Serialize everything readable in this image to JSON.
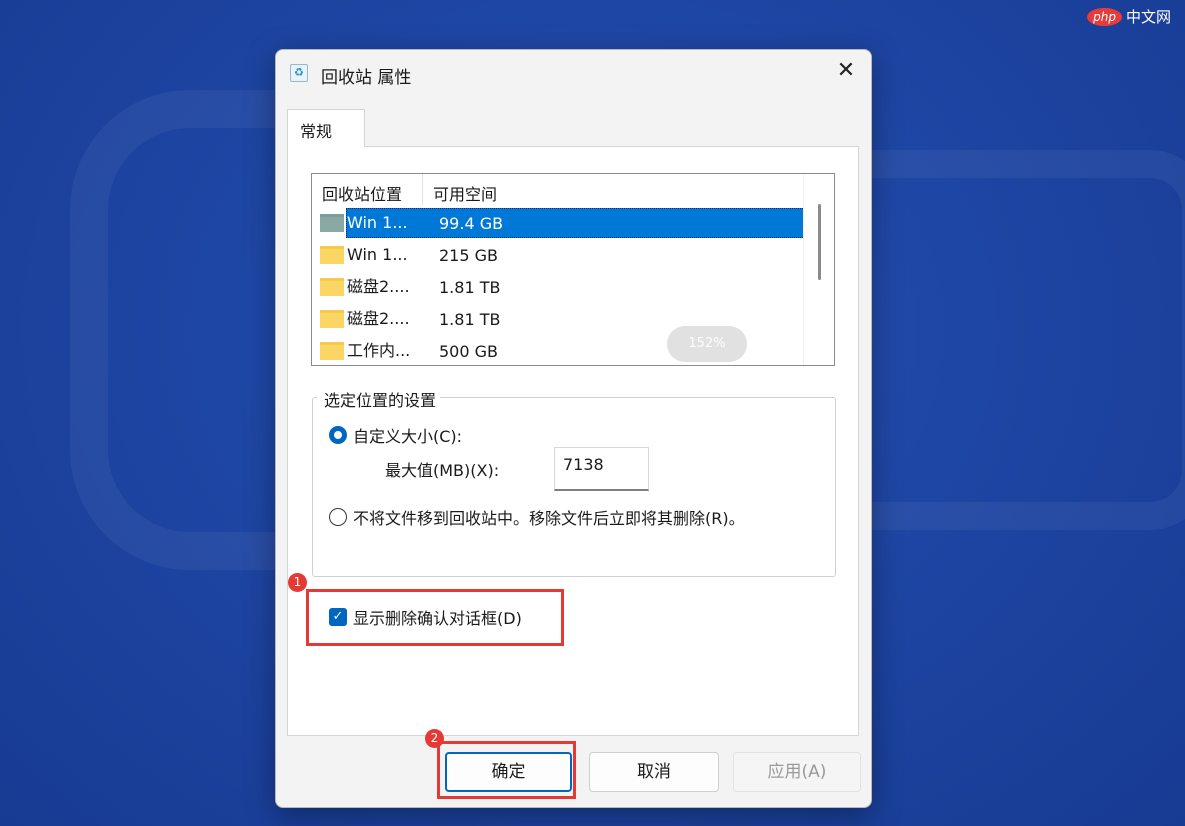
{
  "watermark": {
    "logo": "php",
    "text": "中文网"
  },
  "dialog": {
    "title": "回收站 属性",
    "close_glyph": "✕",
    "tab_label": "常规",
    "list": {
      "columns": [
        "回收站位置",
        "可用空间"
      ],
      "rows": [
        {
          "name": "Win 1...",
          "size": "99.4 GB",
          "icon": "folder-green-icon",
          "selected": true
        },
        {
          "name": "Win 1...",
          "size": "215 GB",
          "icon": "folder-icon",
          "selected": false
        },
        {
          "name": "磁盘2....",
          "size": "1.81 TB",
          "icon": "folder-icon",
          "selected": false
        },
        {
          "name": "磁盘2....",
          "size": "1.81 TB",
          "icon": "folder-icon",
          "selected": false
        },
        {
          "name": "工作内...",
          "size": "500 GB",
          "icon": "folder-icon",
          "selected": false
        }
      ]
    },
    "zoom_badge": "152%",
    "settings": {
      "group_title": "选定位置的设置",
      "custom_size_label": "自定义大小(C):",
      "custom_size_checked": true,
      "max_value_label": "最大值(MB)(X):",
      "max_value": "7138",
      "no_recycle_label": "不将文件移到回收站中。移除文件后立即将其删除(R)。",
      "no_recycle_checked": false
    },
    "confirm_checkbox": {
      "label": "显示删除确认对话框(D)",
      "checked": true,
      "glyph": "✓"
    },
    "buttons": {
      "ok": "确定",
      "cancel": "取消",
      "apply": "应用(A)"
    }
  },
  "annotations": {
    "badge1": "1",
    "badge2": "2",
    "color": "#e53935"
  }
}
